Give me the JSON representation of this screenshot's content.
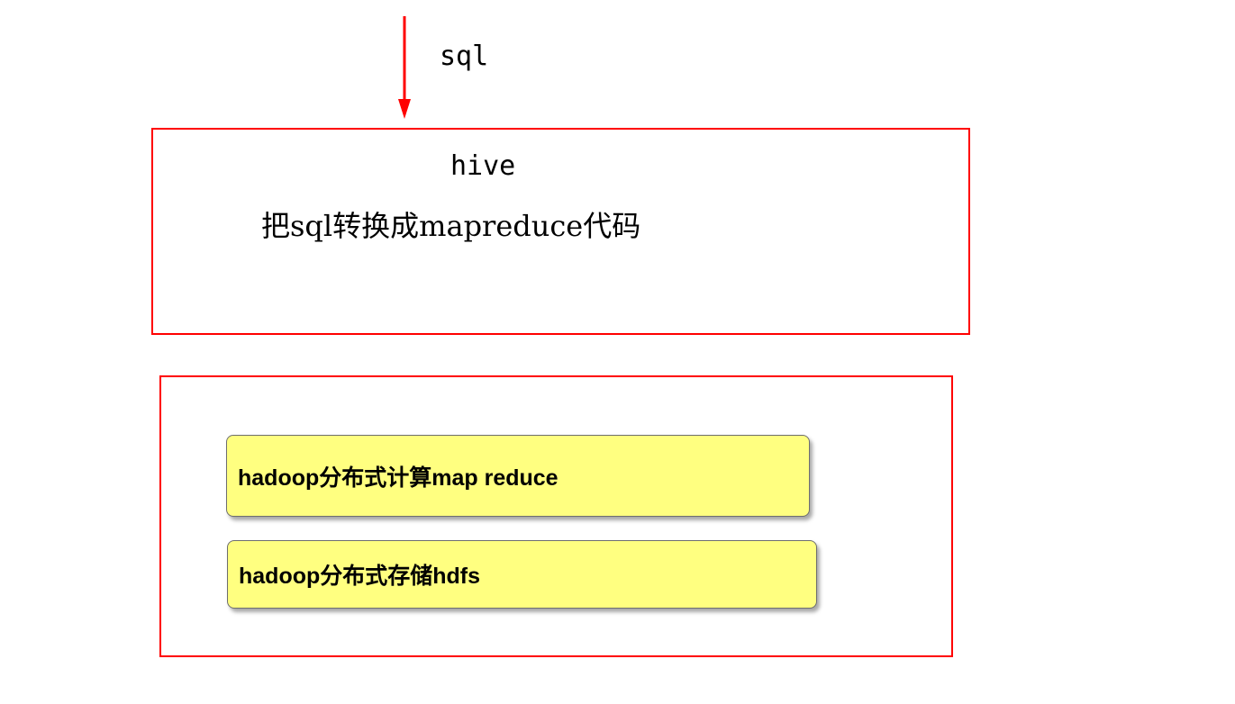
{
  "input": {
    "label": "sql",
    "arrow_color": "#ff0000"
  },
  "hive": {
    "title": "hive",
    "description": "把sql转换成mapreduce代码",
    "border_color": "#ff0000"
  },
  "hadoop": {
    "border_color": "#ff0000",
    "card_color": "#ffff80",
    "compute": "hadoop分布式计算map reduce",
    "storage": "hadoop分布式存储hdfs"
  }
}
